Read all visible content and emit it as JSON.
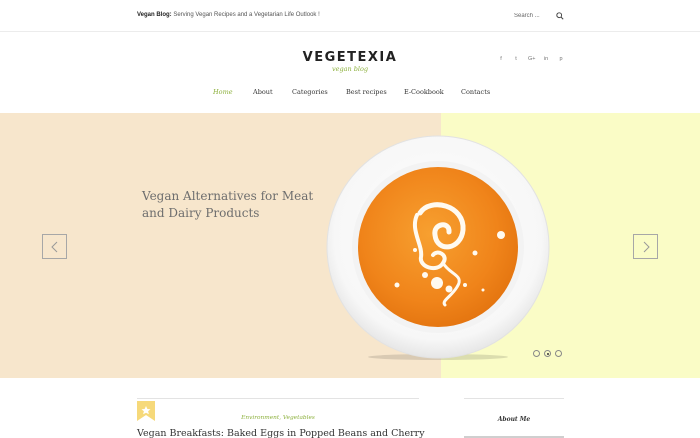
{
  "topbar": {
    "blog_name": "Vegan Blog:",
    "tagline": " Serving Vegan Recipes and a Vegetarian Life Outlook !",
    "search_placeholder": "Search ..."
  },
  "logo": {
    "title": "VEGETEXIA",
    "subtitle": "vegan blog"
  },
  "social": {
    "items": [
      "f",
      "t",
      "G+",
      "in",
      "p"
    ],
    "icons": [
      "facebook-icon",
      "twitter-icon",
      "google-plus-icon",
      "linkedin-icon",
      "pinterest-icon"
    ]
  },
  "nav": {
    "items": [
      "Home",
      "About",
      "Categories",
      "Best recipes",
      "E-Cookbook",
      "Contacts"
    ],
    "active": "Home"
  },
  "hero": {
    "title": "Vegan Alternatives for Meat and Dairy Products",
    "slides": 3,
    "active_slide": 2,
    "colors": {
      "left_bg": "#f7e6cc",
      "right_bg": "#fafcc6",
      "soup": "#f28a1e"
    }
  },
  "post": {
    "categories": "Environment, Vegetables",
    "title": "Vegan Breakfasts: Baked Eggs in Popped Beans and Cherry"
  },
  "sidebar": {
    "title": "About Me"
  },
  "colors": {
    "accent": "#8cb03c"
  }
}
